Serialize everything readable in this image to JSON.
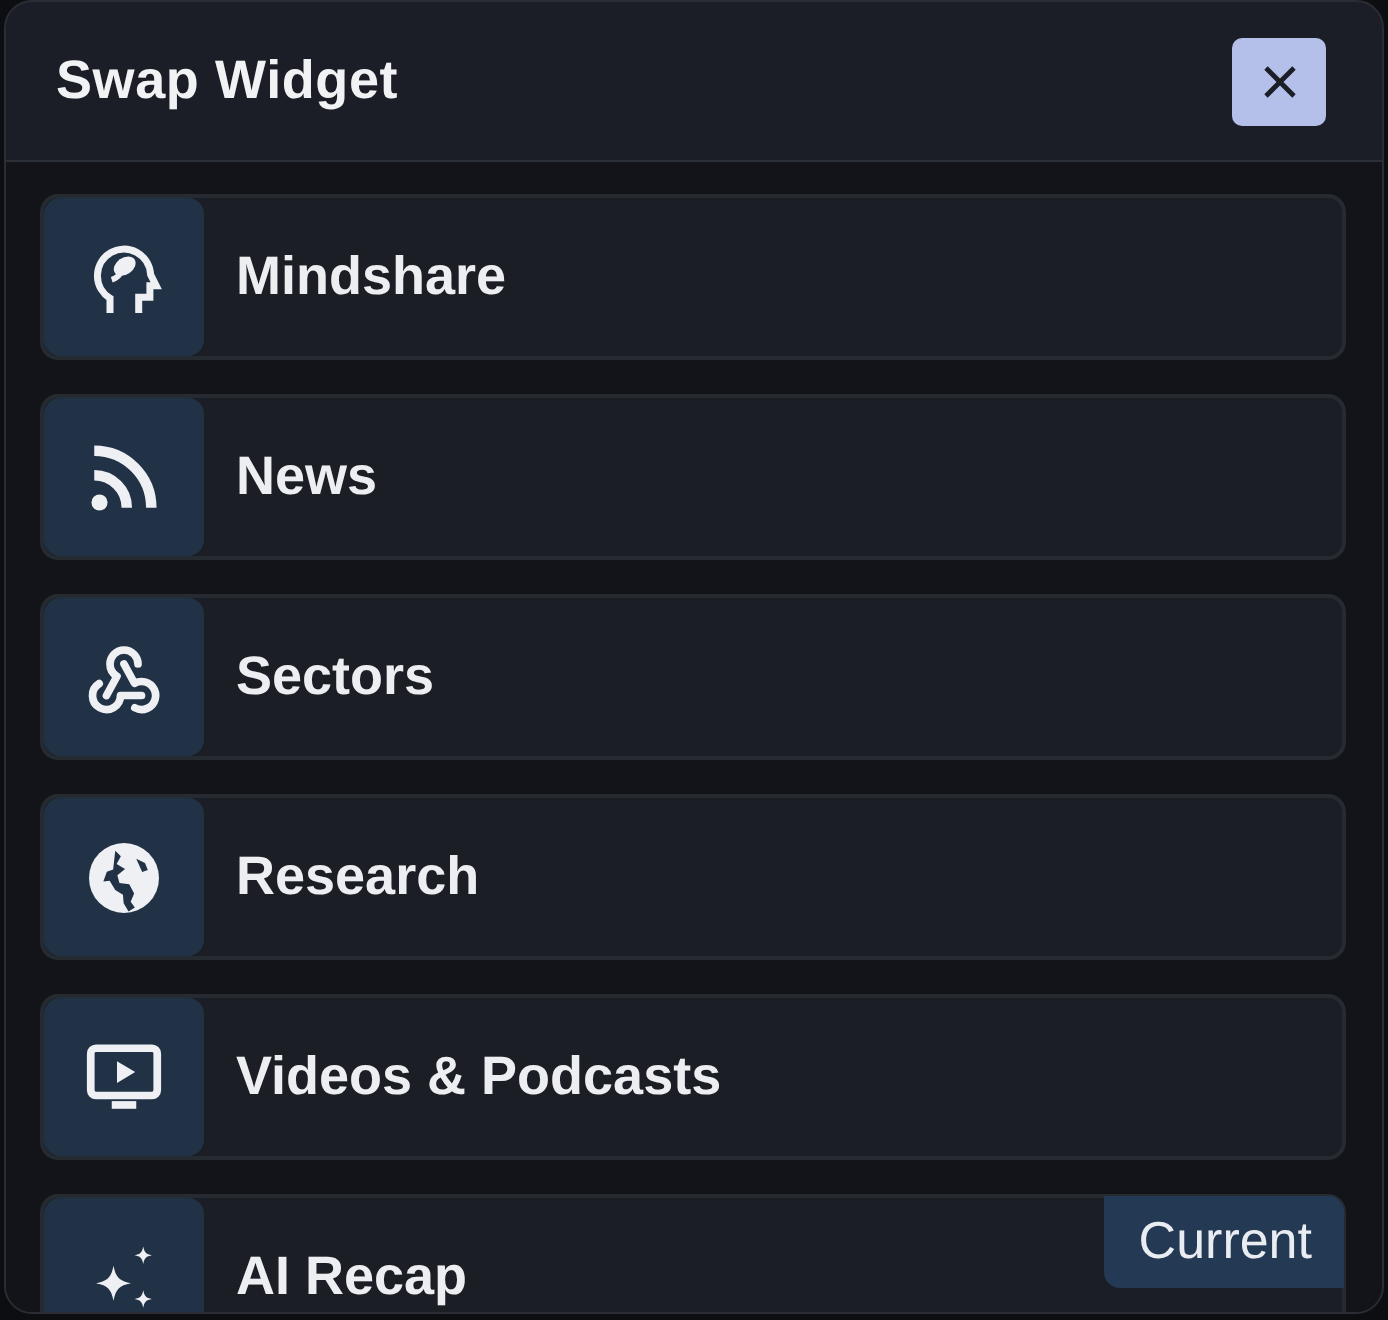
{
  "dialog": {
    "title": "Swap Widget"
  },
  "current_badge": "Current",
  "widgets": [
    {
      "label": "Mindshare",
      "kind": "mindshare",
      "current": false
    },
    {
      "label": "News",
      "kind": "news",
      "current": false
    },
    {
      "label": "Sectors",
      "kind": "sectors",
      "current": false
    },
    {
      "label": "Research",
      "kind": "research",
      "current": false
    },
    {
      "label": "Videos & Podcasts",
      "kind": "videos",
      "current": false
    },
    {
      "label": "AI Recap",
      "kind": "recap",
      "current": true
    }
  ]
}
